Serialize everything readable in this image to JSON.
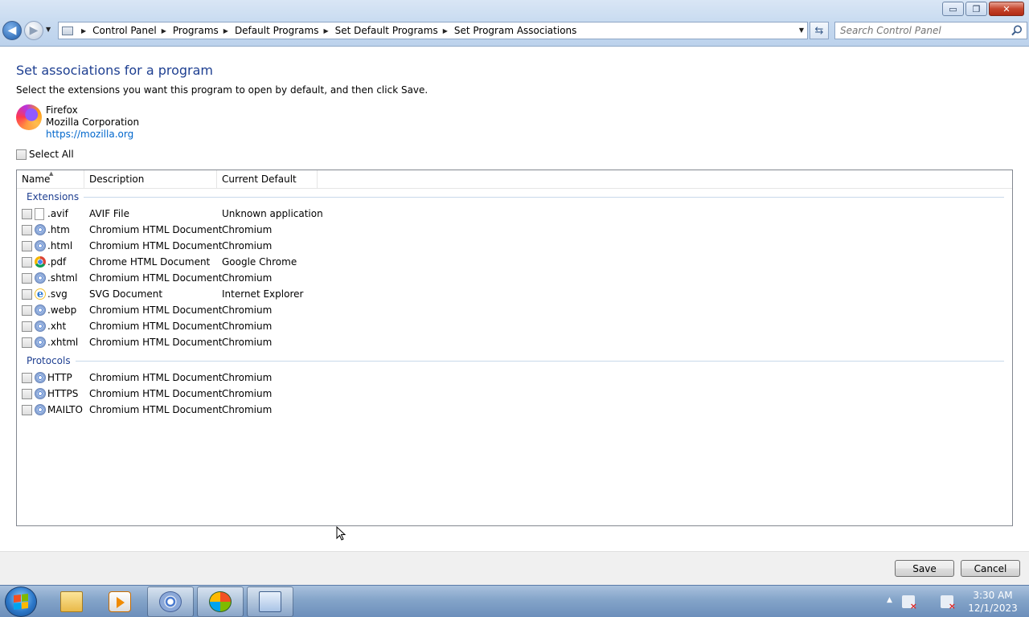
{
  "window": {
    "buttons": {
      "minimize": "▭",
      "maximize": "❐",
      "close": "✕"
    }
  },
  "address": {
    "breadcrumbs": [
      "Control Panel",
      "Programs",
      "Default Programs",
      "Set Default Programs",
      "Set Program Associations"
    ],
    "search_placeholder": "Search Control Panel"
  },
  "page": {
    "title": "Set associations for a program",
    "subtitle": "Select the extensions you want this program to open by default, and then click Save.",
    "program": {
      "name": "Firefox",
      "publisher": "Mozilla Corporation",
      "url": "https://mozilla.org"
    },
    "select_all_label": "Select All"
  },
  "list": {
    "columns": [
      "Name",
      "Description",
      "Current Default"
    ],
    "groups": [
      {
        "label": "Extensions",
        "rows": [
          {
            "name": ".avif",
            "description": "AVIF File",
            "default": "Unknown application",
            "icon": "file-icon"
          },
          {
            "name": ".htm",
            "description": "Chromium HTML Document",
            "default": "Chromium",
            "icon": "chromium-icon"
          },
          {
            "name": ".html",
            "description": "Chromium HTML Document",
            "default": "Chromium",
            "icon": "chromium-icon"
          },
          {
            "name": ".pdf",
            "description": "Chrome HTML Document",
            "default": "Google Chrome",
            "icon": "chrome-icon"
          },
          {
            "name": ".shtml",
            "description": "Chromium HTML Document",
            "default": "Chromium",
            "icon": "chromium-icon"
          },
          {
            "name": ".svg",
            "description": "SVG Document",
            "default": "Internet Explorer",
            "icon": "ie-icon"
          },
          {
            "name": ".webp",
            "description": "Chromium HTML Document",
            "default": "Chromium",
            "icon": "chromium-icon"
          },
          {
            "name": ".xht",
            "description": "Chromium HTML Document",
            "default": "Chromium",
            "icon": "chromium-icon"
          },
          {
            "name": ".xhtml",
            "description": "Chromium HTML Document",
            "default": "Chromium",
            "icon": "chromium-icon"
          }
        ]
      },
      {
        "label": "Protocols",
        "rows": [
          {
            "name": "HTTP",
            "description": "Chromium HTML Document",
            "default": "Chromium",
            "icon": "chromium-icon"
          },
          {
            "name": "HTTPS",
            "description": "Chromium HTML Document",
            "default": "Chromium",
            "icon": "chromium-icon"
          },
          {
            "name": "MAILTO",
            "description": "Chromium HTML Document",
            "default": "Chromium",
            "icon": "chromium-icon"
          }
        ]
      }
    ]
  },
  "footer": {
    "save": "Save",
    "cancel": "Cancel"
  },
  "taskbar": {
    "items": [
      "folder-icon",
      "media-player-icon",
      "chromium-icon",
      "windows-media-icon",
      "control-panel-icon"
    ],
    "clock": {
      "time": "3:30 AM",
      "date": "12/1/2023"
    }
  },
  "colors": {
    "title_blue": "#1e3f91",
    "link_blue": "#0066cc",
    "group_blue": "#1e3f91"
  }
}
